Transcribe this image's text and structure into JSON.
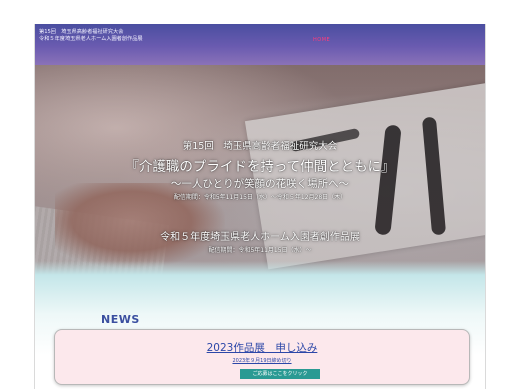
{
  "header": {
    "title_line1": "第15回　埼玉県高齢者福祉研究大会",
    "title_line2": "令和５年度埼玉県老人ホーム入園者創作品展",
    "nav_home": "HOME"
  },
  "hero": {
    "line1": "第15回　埼玉県高齢者福祉研究大会",
    "line2": "『介護職のプライドを持って仲間とともに』",
    "line3": "～一人ひとりが笑顔の花咲く場所へ～",
    "line4": "配信期間：令和5年11月15日（水）～令和５年12月28日（木）",
    "line5": "令和５年度埼玉県老人ホーム入園者創作品展",
    "line6": "配信期間：令和5年11月15日（水）～"
  },
  "news": {
    "heading": "NEWS",
    "card": {
      "headline": "2023作品展　申し込み",
      "deadline": "2023年９月19日締め切り",
      "button_label": "ご応募はここをクリック"
    }
  },
  "colors": {
    "header_bg": "#5b55a8",
    "nav_accent": "#ff3b7c",
    "news_heading": "#3b4fa0",
    "card_bg": "#fce8ec",
    "button_bg": "#2a9a93",
    "link_blue": "#2c47a8"
  }
}
